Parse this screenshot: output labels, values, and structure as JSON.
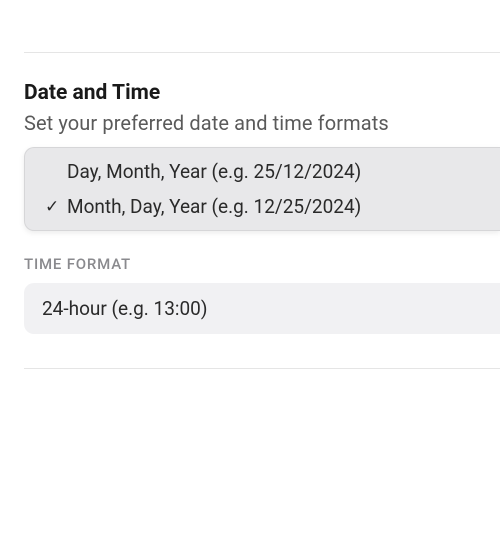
{
  "section": {
    "title": "Date and Time",
    "subtitle": "Set your preferred date and time formats"
  },
  "dateFormat": {
    "options": [
      {
        "label": "Day, Month, Year (e.g. 25/12/2024)",
        "selected": false
      },
      {
        "label": "Month, Day, Year (e.g. 12/25/2024)",
        "selected": true
      }
    ]
  },
  "timeFormat": {
    "label": "TIME FORMAT",
    "value": "24-hour (e.g. 13:00)"
  },
  "icons": {
    "check": "✓"
  }
}
